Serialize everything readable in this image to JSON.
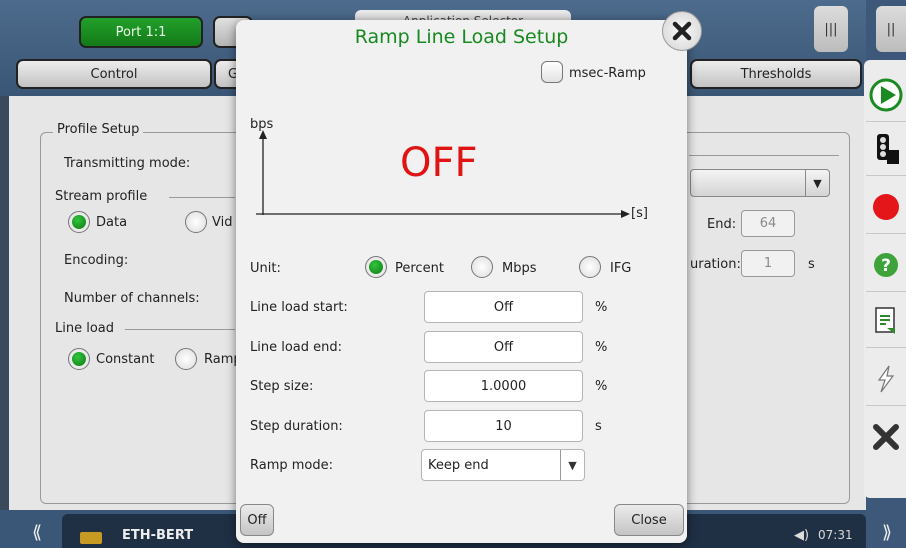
{
  "top": {
    "port_label": "Port 1:1",
    "app_selector_label": "Application Selector",
    "tabs": [
      "Control",
      "G",
      "Thresholds"
    ]
  },
  "background": {
    "profile_setup_title": "Profile Setup",
    "transmitting_mode_label": "Transmitting mode:",
    "stream_profile_title": "Stream profile",
    "stream_profile_options": [
      "Data",
      "Vid"
    ],
    "encoding_label": "Encoding:",
    "number_of_channels_label": "Number of channels:",
    "line_load_title": "Line load",
    "line_load_options": [
      "Constant",
      "Ramp"
    ],
    "end_label": "End:",
    "end_value": "64",
    "duration_label": "uration:",
    "duration_value": "1",
    "duration_unit": "s"
  },
  "dialog": {
    "title": "Ramp Line Load Setup",
    "msec_ramp_label": "msec-Ramp",
    "msec_ramp_checked": false,
    "chart": {
      "y_label": "bps",
      "x_label": "[s]",
      "status_text": "OFF"
    },
    "unit": {
      "label": "Unit:",
      "options": [
        "Percent",
        "Mbps",
        "IFG"
      ],
      "selected": "Percent"
    },
    "line_load_start": {
      "label": "Line load start:",
      "value": "Off",
      "unit": "%"
    },
    "line_load_end": {
      "label": "Line load end:",
      "value": "Off",
      "unit": "%"
    },
    "step_size": {
      "label": "Step size:",
      "value": "1.0000",
      "unit": "%"
    },
    "step_duration": {
      "label": "Step duration:",
      "value": "10",
      "unit": "s"
    },
    "ramp_mode": {
      "label": "Ramp mode:",
      "value": "Keep end"
    },
    "off_button_label": "Off",
    "close_button_label": "Close"
  },
  "statusbar": {
    "app_name": "ETH-BERT",
    "time": "07:31"
  },
  "icons": {
    "accent_green": "#178a20",
    "off_red": "#e11414"
  }
}
